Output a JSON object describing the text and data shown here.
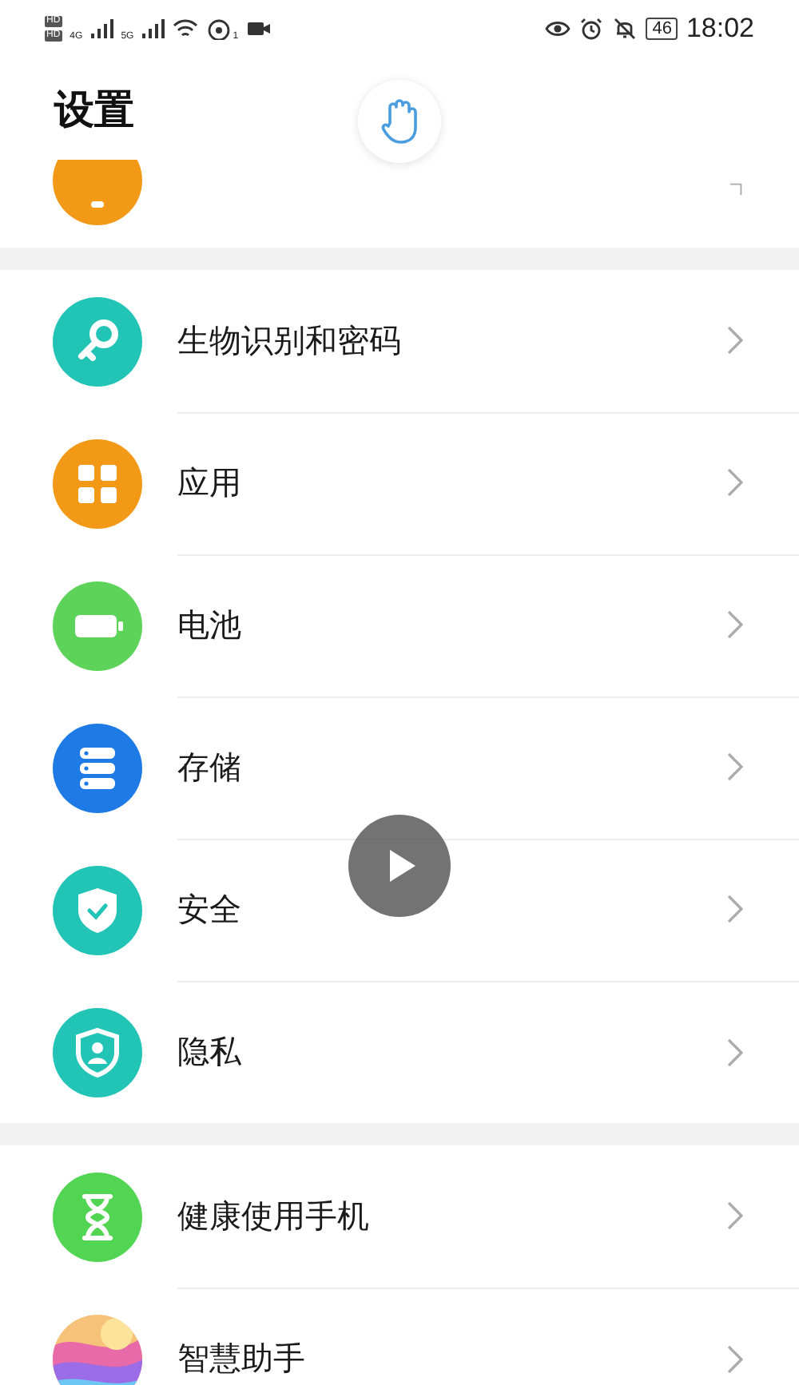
{
  "status_bar": {
    "hd_badges": [
      "HD",
      "HD"
    ],
    "networks": [
      "4G",
      "5G"
    ],
    "hotspot_count": "1",
    "battery": "46",
    "time": "18:02"
  },
  "header": {
    "title": "设置"
  },
  "partial_row": {
    "kind": "notification",
    "color": "#f29a17"
  },
  "groups": [
    {
      "items": [
        {
          "kind": "key",
          "label": "生物识别和密码",
          "color": "#22c4b5"
        },
        {
          "kind": "apps",
          "label": "应用",
          "color": "#f29a17"
        },
        {
          "kind": "battery",
          "label": "电池",
          "color": "#5ed35a"
        },
        {
          "kind": "storage",
          "label": "存储",
          "color": "#1e7be6"
        },
        {
          "kind": "security",
          "label": "安全",
          "color": "#22c4b5"
        },
        {
          "kind": "privacy",
          "label": "隐私",
          "color": "#22c4b5"
        }
      ]
    },
    {
      "items": [
        {
          "kind": "hourglass",
          "label": "健康使用手机",
          "color": "#52d552"
        },
        {
          "kind": "assistant",
          "label": "智慧助手"
        }
      ]
    }
  ]
}
